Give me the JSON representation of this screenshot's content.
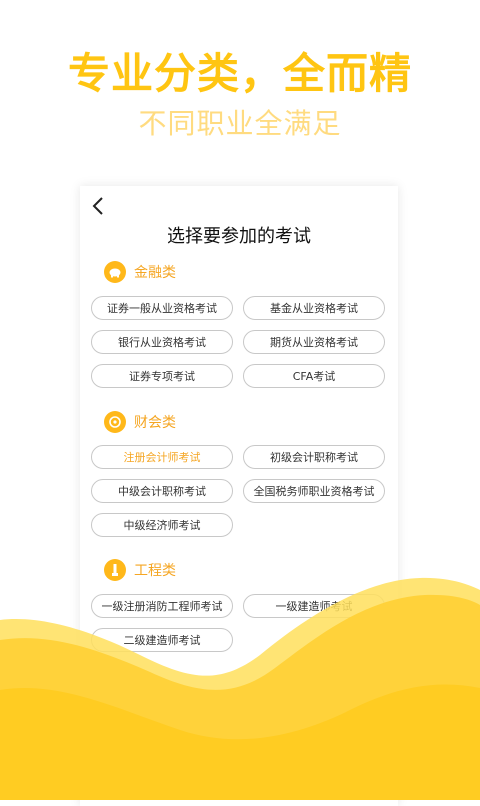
{
  "headline": "专业分类，全而精",
  "subheadline": "不同职业全满足",
  "screen": {
    "title": "选择要参加的考试",
    "sections": [
      {
        "label": "金融类",
        "icon": "piggy-bank-icon",
        "items": [
          "证券一般从业资格考试",
          "基金从业资格考试",
          "银行从业资格考试",
          "期货从业资格考试",
          "证券专项考试",
          "CFA考试"
        ]
      },
      {
        "label": "财会类",
        "icon": "coin-icon",
        "items": [
          "注册会计师考试",
          "初级会计职称考试",
          "中级会计职称考试",
          "全国税务师职业资格考试",
          "中级经济师考试"
        ],
        "selected": "注册会计师考试"
      },
      {
        "label": "工程类",
        "icon": "engineering-icon",
        "items": [
          "一级注册消防工程师考试",
          "一级建造师考试",
          "二级建造师考试"
        ]
      }
    ]
  },
  "colors": {
    "accent": "#FFC512",
    "accent_text": "#F5A623",
    "wave": "#FFD23A"
  }
}
